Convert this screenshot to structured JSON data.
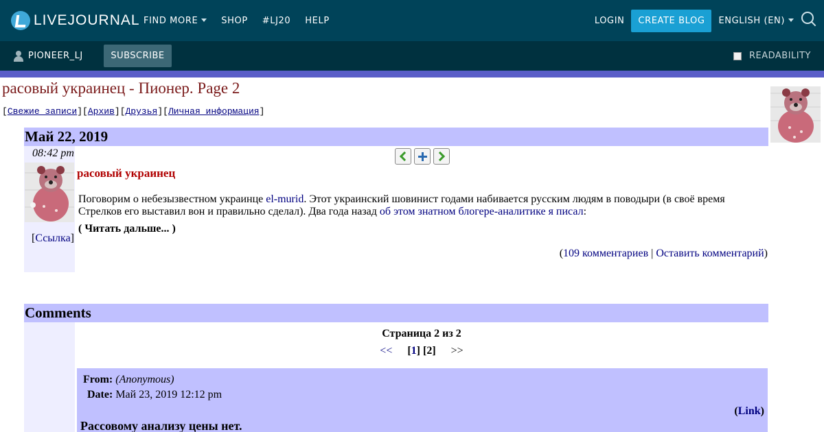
{
  "topbar": {
    "logo_text": "LIVEJOURNAL",
    "nav": [
      "FIND MORE",
      "SHOP",
      "#LJ20",
      "HELP"
    ],
    "login": "LOGIN",
    "create_blog": "CREATE BLOG",
    "language": "ENGLISH (EN)",
    "bg_color": "#004359",
    "accent_color": "#1aa0d4"
  },
  "subbar": {
    "username": "PIONEER_LJ",
    "subscribe": "SUBSCRIBE",
    "readability": "READABILITY"
  },
  "journal": {
    "title": "расовый украинец - Пионер. Page 2",
    "nav": {
      "lbracket": "[",
      "rbracket": "]",
      "recent": "Свежие записи",
      "archive": "Архив",
      "friends": "Друзья",
      "info": "Личная информация"
    }
  },
  "entry": {
    "date": "Май 22, 2019",
    "time": "08:42 pm",
    "subject": "расовый украинец",
    "body_1": "Поговорим о небезызвестном украинце ",
    "user_link": "el-murid",
    "body_2": ". Этот украинский шовинист годами набивается русским людям в поводыри (в своё время Стрелков его выставил вон и правильно сделал). Два года назад ",
    "body_link": "об этом знатном блогере-аналитике я писал",
    "body_3": ":",
    "read_more_open": "( ",
    "read_more": "Читать дальше...",
    "read_more_close": " )",
    "permalink": "Ссылка",
    "comments_count": "109 комментариев",
    "leave_comment": "Оставить комментарий",
    "separator": " | "
  },
  "comments": {
    "heading": "Comments",
    "page_info": "Страница 2 из 2",
    "pager": {
      "prev": "<<",
      "page1": "1",
      "page2": "[2]",
      "next": ">>"
    },
    "first": {
      "from_label": "From:",
      "from_value": "(Anonymous)",
      "date_label": "Date:",
      "date_value": "Май 23, 2019 12:12 pm",
      "link": "Link",
      "subject": "Рассовому анализу цены нет."
    }
  }
}
